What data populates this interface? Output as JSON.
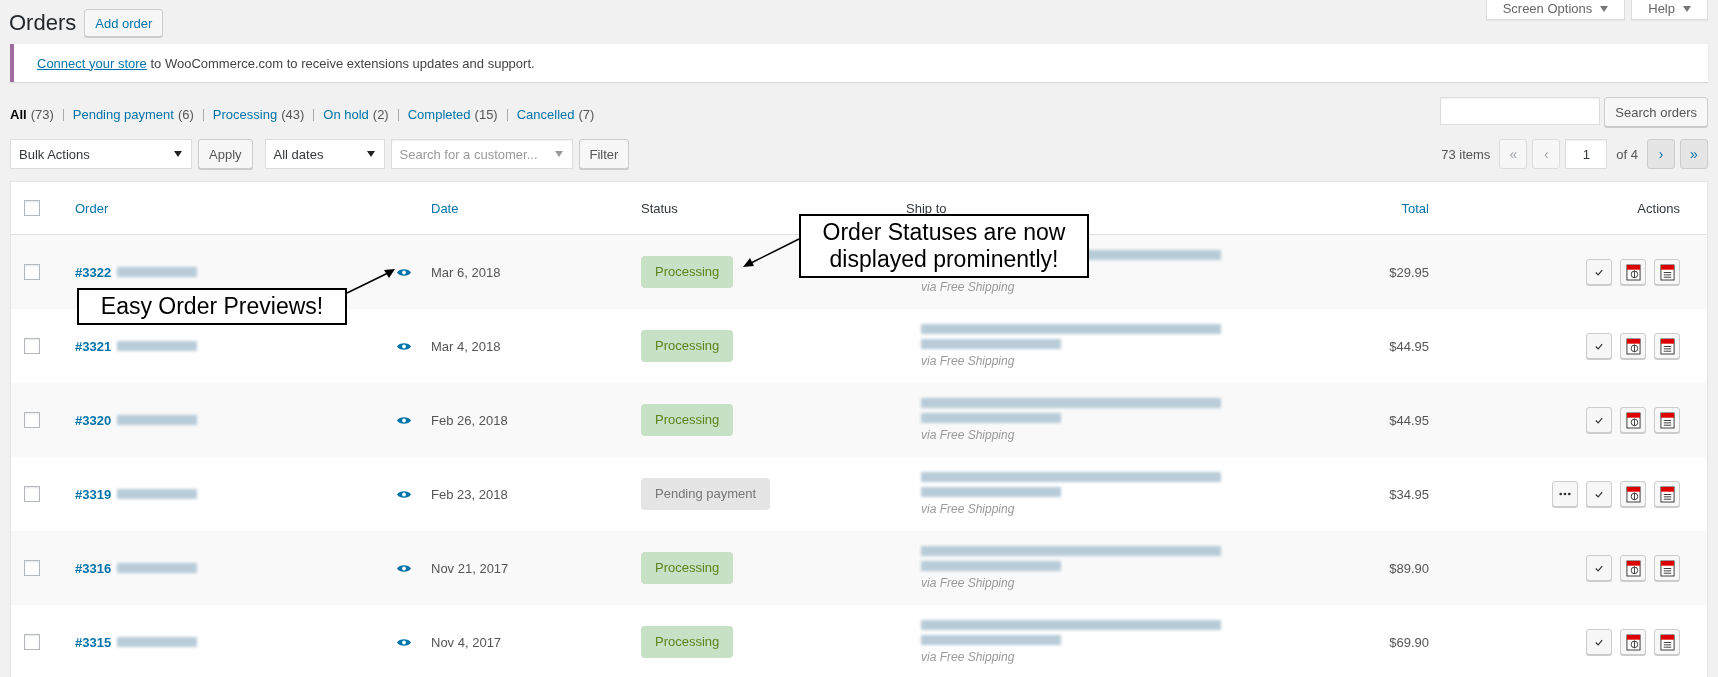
{
  "page_title": "Orders",
  "add_button": "Add order",
  "top_tabs": [
    {
      "label": "Screen Options"
    },
    {
      "label": "Help"
    }
  ],
  "notice": {
    "link": "Connect your store",
    "text": " to WooCommerce.com to receive extensions updates and support."
  },
  "filters": [
    {
      "label": "All",
      "count": "(73)",
      "selected": true
    },
    {
      "label": "Pending payment",
      "count": "(6)",
      "selected": false
    },
    {
      "label": "Processing",
      "count": "(43)",
      "selected": false
    },
    {
      "label": "On hold",
      "count": "(2)",
      "selected": false
    },
    {
      "label": "Completed",
      "count": "(15)",
      "selected": false
    },
    {
      "label": "Cancelled",
      "count": "(7)",
      "selected": false
    }
  ],
  "search_button": "Search orders",
  "bulk_actions": "Bulk Actions",
  "apply_button": "Apply",
  "dates": "All dates",
  "customer_search": {
    "placeholder": "Search for a customer..."
  },
  "filter_button": "Filter",
  "pagination": {
    "items": "73 items",
    "page": "1",
    "of": "of 4",
    "buttons": [
      {
        "label": "«",
        "disabled": true
      },
      {
        "label": "‹",
        "disabled": true
      },
      {
        "label": "›",
        "disabled": false
      },
      {
        "label": "»",
        "disabled": false
      }
    ]
  },
  "table": {
    "columns": [
      {
        "label": "Order",
        "sortable": true
      },
      {
        "label": "Date",
        "sortable": true
      },
      {
        "label": "Status",
        "sortable": false
      },
      {
        "label": "Ship to",
        "sortable": false
      },
      {
        "label": "Total",
        "sortable": true
      },
      {
        "label": "Actions",
        "sortable": false
      }
    ],
    "header_checked": false,
    "rows": [
      {
        "checked": false,
        "order": "#3322",
        "date": "Mar 6, 2018",
        "status": {
          "label": "Processing",
          "kind": "processing"
        },
        "shipping": "via Free Shipping",
        "total": "$29.95",
        "actions": [
          {
            "kind": "complete"
          },
          {
            "kind": "invoice"
          },
          {
            "kind": "packing-slip"
          }
        ]
      },
      {
        "checked": false,
        "order": "#3321",
        "date": "Mar 4, 2018",
        "status": {
          "label": "Processing",
          "kind": "processing"
        },
        "shipping": "via Free Shipping",
        "total": "$44.95",
        "actions": [
          {
            "kind": "complete"
          },
          {
            "kind": "invoice"
          },
          {
            "kind": "packing-slip"
          }
        ]
      },
      {
        "checked": false,
        "order": "#3320",
        "date": "Feb 26, 2018",
        "status": {
          "label": "Processing",
          "kind": "processing"
        },
        "shipping": "via Free Shipping",
        "total": "$44.95",
        "actions": [
          {
            "kind": "complete"
          },
          {
            "kind": "invoice"
          },
          {
            "kind": "packing-slip"
          }
        ]
      },
      {
        "checked": false,
        "order": "#3319",
        "date": "Feb 23, 2018",
        "status": {
          "label": "Pending payment",
          "kind": "pending"
        },
        "shipping": "via Free Shipping",
        "total": "$34.95",
        "actions": [
          {
            "kind": "processing"
          },
          {
            "kind": "complete"
          },
          {
            "kind": "invoice"
          },
          {
            "kind": "packing-slip"
          }
        ]
      },
      {
        "checked": false,
        "order": "#3316",
        "date": "Nov 21, 2017",
        "status": {
          "label": "Processing",
          "kind": "processing"
        },
        "shipping": "via Free Shipping",
        "total": "$89.90",
        "actions": [
          {
            "kind": "complete"
          },
          {
            "kind": "invoice"
          },
          {
            "kind": "packing-slip"
          }
        ]
      },
      {
        "checked": false,
        "order": "#3315",
        "date": "Nov 4, 2017",
        "status": {
          "label": "Processing",
          "kind": "processing"
        },
        "shipping": "via Free Shipping",
        "total": "$69.90",
        "actions": [
          {
            "kind": "complete"
          },
          {
            "kind": "invoice"
          },
          {
            "kind": "packing-slip"
          }
        ]
      }
    ]
  },
  "annotations": [
    {
      "text": "Easy Order Previews!"
    },
    {
      "text": "Order Statuses are now displayed prominently!"
    }
  ]
}
